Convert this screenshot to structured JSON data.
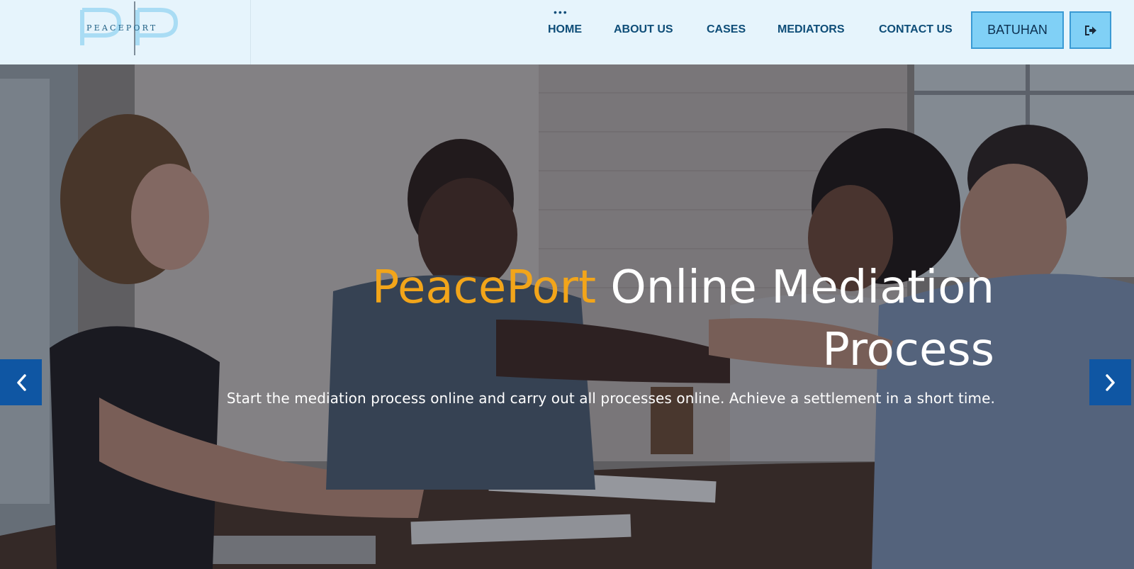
{
  "logo": {
    "monogram": "PP",
    "text": "PEACEPORT"
  },
  "nav": {
    "more_icon": "more-dots-icon",
    "items": [
      {
        "label": "HOME"
      },
      {
        "label": "ABOUT US"
      },
      {
        "label": "CASES"
      },
      {
        "label": "MEDIATORS"
      },
      {
        "label": "CONTACT US"
      }
    ],
    "user_button": "BATUHAN",
    "logout_icon": "sign-out-icon"
  },
  "hero": {
    "title_brand": "PeacePort",
    "title_line1_rest": " Online Mediation",
    "title_line2": "Process",
    "subtitle": "Start the mediation process online and carry out all processes online. Achieve a settlement in a short time.",
    "prev_icon": "chevron-left-icon",
    "next_icon": "chevron-right-icon"
  },
  "colors": {
    "header_bg": "#e6f4fc",
    "nav_text": "#0e4d78",
    "button_bg": "#80d0f6",
    "brand_orange": "#f2a51a",
    "arrow_bg": "#0f56a3"
  }
}
